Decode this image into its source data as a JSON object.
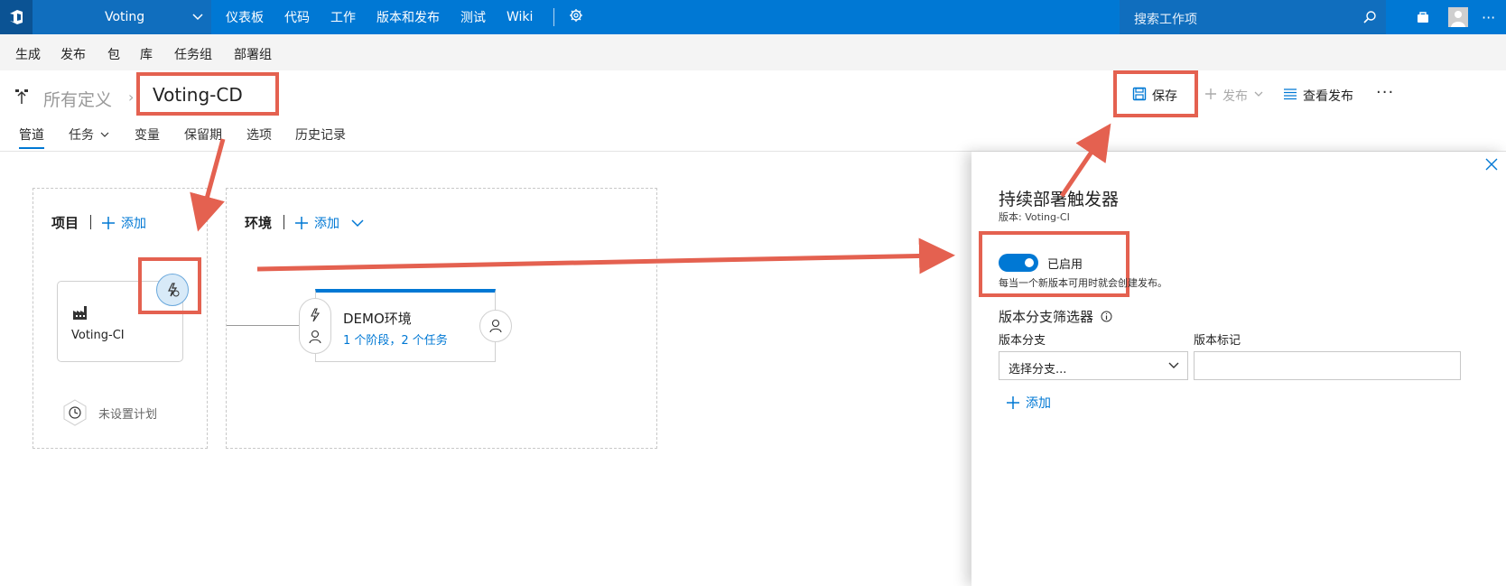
{
  "topbar": {
    "project_name": "Voting",
    "nav": [
      "仪表板",
      "代码",
      "工作",
      "版本和发布",
      "测试",
      "Wiki"
    ],
    "search_placeholder": "搜索工作项"
  },
  "subnav": [
    "生成",
    "发布",
    "包",
    "库",
    "任务组",
    "部署组"
  ],
  "header": {
    "breadcrumb": "所有定义",
    "title": "Voting-CD",
    "save_label": "保存",
    "release_label": "发布",
    "view_releases_label": "查看发布",
    "more_label": "···"
  },
  "tabs": [
    "管道",
    "任务",
    "变量",
    "保留期",
    "选项",
    "历史记录"
  ],
  "pipeline": {
    "artifacts_title": "项目",
    "artifacts_add": "添加",
    "artifact_name": "Voting-CI",
    "schedule_label": "未设置计划",
    "environments_title": "环境",
    "environments_add": "添加",
    "environment": {
      "name": "DEMO环境",
      "summary": "1 个阶段，2 个任务"
    }
  },
  "panel": {
    "title": "持续部署触发器",
    "subtitle": "版本: Voting-CI",
    "toggle_label": "已启用",
    "toggle_on": true,
    "description": "每当一个新版本可用时就会创建发布。",
    "filter_heading": "版本分支筛选器",
    "branch_label": "版本分支",
    "tag_label": "版本标记",
    "branch_placeholder": "选择分支...",
    "tag_value": "",
    "add_label": "添加"
  },
  "colors": {
    "accent": "#0078d4",
    "annotation": "#e46150"
  }
}
